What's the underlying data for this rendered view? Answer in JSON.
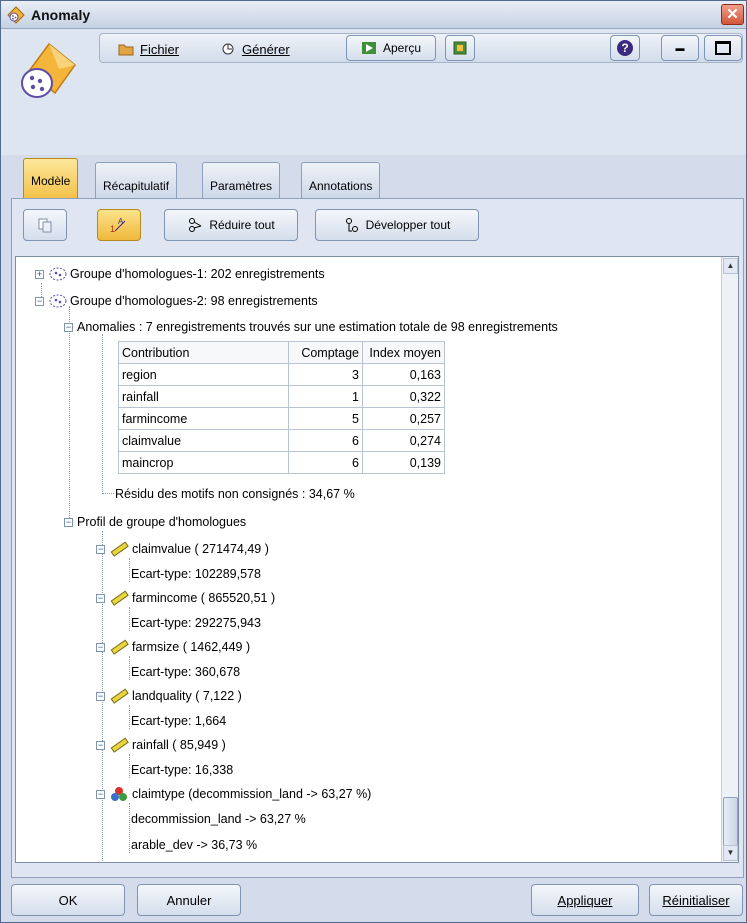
{
  "window": {
    "title": "Anomaly",
    "close_symbol": "✕"
  },
  "menubar": {
    "fichier": "Fichier",
    "generer": "Générer",
    "apercu": "Aperçu",
    "help_symbol": "?",
    "minimize_symbol": "▬"
  },
  "tabs": [
    {
      "label": "Modèle",
      "active": true
    },
    {
      "label": "Récapitulatif",
      "active": false
    },
    {
      "label": "Paramètres",
      "active": false
    },
    {
      "label": "Annotations",
      "active": false
    }
  ],
  "toolbar": {
    "collapse_all": "Réduire tout",
    "expand_all": "Développer tout"
  },
  "tree": {
    "group1": "Groupe d'homologues-1: 202 enregistrements",
    "group2": "Groupe d'homologues-2: 98 enregistrements",
    "anomalies": "Anomalies : 7 enregistrements trouvés sur une estimation totale de 98 enregistrements",
    "table": {
      "headers": [
        "Contribution",
        "Comptage",
        "Index moyen"
      ],
      "rows": [
        [
          "region",
          "3",
          "0,163"
        ],
        [
          "rainfall",
          "1",
          "0,322"
        ],
        [
          "farmincome",
          "5",
          "0,257"
        ],
        [
          "claimvalue",
          "6",
          "0,274"
        ],
        [
          "maincrop",
          "6",
          "0,139"
        ]
      ]
    },
    "residual": "Résidu des motifs non consignés : 34,67 %",
    "profile": "Profil de groupe d'homologues",
    "fields": [
      {
        "name": "claimvalue ( 271474,49 )",
        "sd": "Ecart-type: 102289,578"
      },
      {
        "name": "farmincome ( 865520,51 )",
        "sd": "Ecart-type: 292275,943"
      },
      {
        "name": "farmsize ( 1462,449 )",
        "sd": "Ecart-type: 360,678"
      },
      {
        "name": "landquality ( 7,122 )",
        "sd": "Ecart-type: 1,664"
      },
      {
        "name": "rainfall ( 85,949 )",
        "sd": "Ecart-type: 16,338"
      }
    ],
    "claimtype": "claimtype (decommission_land -> 63,27 %)",
    "claimtype_values": [
      "decommission_land -> 63,27 %",
      "arable_dev -> 36,73 %"
    ]
  },
  "footer": {
    "ok": "OK",
    "annuler": "Annuler",
    "appliquer": "Appliquer",
    "reinitialiser": "Réinitialiser"
  },
  "colors": {
    "accent_tab": "#f4c24b",
    "window_bg": "#d4dceb"
  }
}
